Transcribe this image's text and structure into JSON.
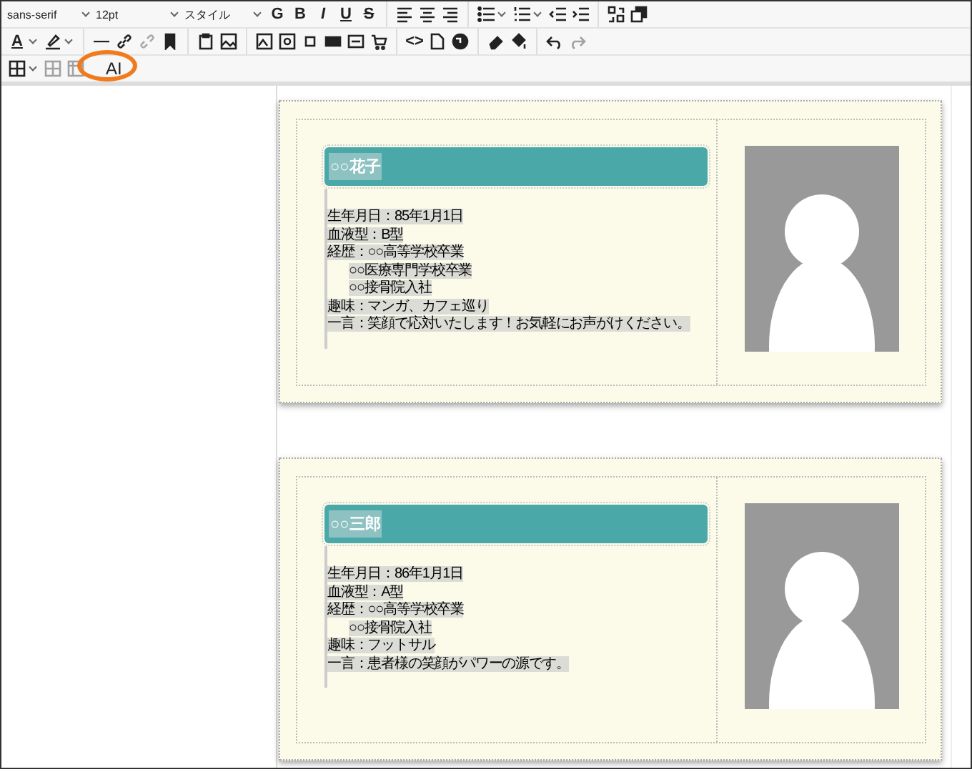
{
  "toolbar": {
    "rows": [
      [
        {
          "kind": "select",
          "label": "sans-serif"
        },
        {
          "kind": "select",
          "label": "12pt"
        },
        {
          "kind": "select",
          "label": "スタイル"
        },
        {
          "kind": "bold",
          "label": "G"
        },
        {
          "kind": "bold",
          "label": "B"
        },
        {
          "kind": "italic",
          "label": "I"
        },
        {
          "kind": "underline",
          "label": "U"
        },
        {
          "kind": "strike",
          "label": "S"
        },
        {
          "kind": "separator"
        },
        {
          "kind": "icon"
        },
        {
          "kind": "icon"
        },
        {
          "kind": "icon"
        },
        {
          "kind": "separator"
        },
        {
          "kind": "icon",
          "caret": true
        },
        {
          "kind": "icon",
          "caret": true
        },
        {
          "kind": "icon"
        },
        {
          "kind": "icon"
        },
        {
          "kind": "separator"
        },
        {
          "kind": "icon"
        },
        {
          "kind": "icon"
        }
      ],
      [
        {
          "kind": "underline",
          "label": "A",
          "caret": true
        },
        {
          "kind": "icon",
          "caret": true
        },
        {
          "kind": "separator"
        },
        {
          "kind": "bold",
          "label": "—"
        },
        {
          "kind": "icon"
        },
        {
          "kind": "icon"
        },
        {
          "kind": "icon"
        },
        {
          "kind": "separator"
        },
        {
          "kind": "icon"
        },
        {
          "kind": "icon"
        },
        {
          "kind": "separator"
        },
        {
          "kind": "icon"
        },
        {
          "kind": "icon"
        },
        {
          "kind": "icon"
        },
        {
          "kind": "icon"
        },
        {
          "kind": "icon"
        },
        {
          "kind": "icon"
        },
        {
          "kind": "separator"
        },
        {
          "kind": "bold",
          "label": "<>"
        },
        {
          "kind": "icon"
        },
        {
          "kind": "icon"
        },
        {
          "kind": "separator"
        },
        {
          "kind": "icon"
        },
        {
          "kind": "icon"
        },
        {
          "kind": "separator"
        },
        {
          "kind": "icon"
        },
        {
          "kind": "icon",
          "disabled": true
        }
      ],
      [
        {
          "kind": "icon",
          "caret": true
        },
        {
          "kind": "icon",
          "disabled": true
        },
        {
          "kind": "icon",
          "disabled": true
        },
        {
          "kind": "plain",
          "label": "AI",
          "circled": true
        }
      ]
    ]
  },
  "cards": [
    {
      "name": "○○花子",
      "lines": [
        {
          "text": "生年月日：85年1月1日",
          "indented": false
        },
        {
          "text": "血液型：B型",
          "indented": false
        },
        {
          "text": "経歴：○○高等学校卒業",
          "indented": false
        },
        {
          "text": "○○医療専門学校卒業",
          "indented": true
        },
        {
          "text": "○○接骨院入社",
          "indented": true
        },
        {
          "text": "趣味：マンガ、カフェ巡り",
          "indented": false
        },
        {
          "text": "一言：笑顔で応対いたします！お気軽にお声がけください。",
          "indented": false
        }
      ]
    },
    {
      "name": "○○三郎",
      "lines": [
        {
          "text": "生年月日：86年1月1日",
          "indented": false
        },
        {
          "text": "血液型：A型",
          "indented": false
        },
        {
          "text": "経歴：○○高等学校卒業",
          "indented": false
        },
        {
          "text": "○○接骨院入社",
          "indented": true
        },
        {
          "text": "趣味：フットサル",
          "indented": false
        },
        {
          "text": "一言：患者様の笑顔がパワーの源です。",
          "indented": false
        }
      ]
    }
  ]
}
